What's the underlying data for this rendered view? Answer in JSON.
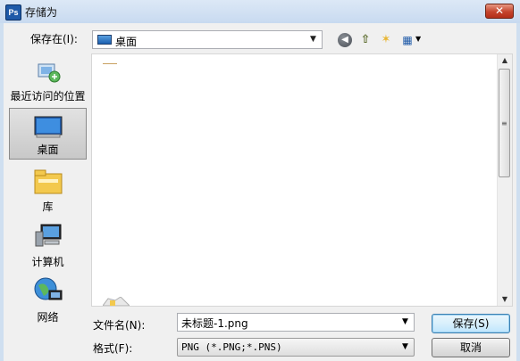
{
  "window": {
    "title": "存储为",
    "app_icon_text": "Ps",
    "close_glyph": "✕"
  },
  "location": {
    "label": "保存在(I):",
    "value": "桌面",
    "arrow": "▼"
  },
  "toolbar": {
    "back_glyph": "◀",
    "up_glyph": "⇧",
    "newfolder_glyph": "✶",
    "view_glyph": "▦",
    "view_arrow": "▼"
  },
  "places": [
    {
      "label": "最近访问的位置",
      "icon": "recent-places-icon"
    },
    {
      "label": "桌面",
      "icon": "desktop-icon",
      "selected": true
    },
    {
      "label": "库",
      "icon": "library-icon"
    },
    {
      "label": "计算机",
      "icon": "computer-icon"
    },
    {
      "label": "网络",
      "icon": "network-icon"
    }
  ],
  "scroll": {
    "up": "▲",
    "down": "▼",
    "grip": "≡"
  },
  "filename": {
    "label": "文件名(N):",
    "value": "未标题-1.png",
    "arrow": "▼"
  },
  "format": {
    "label": "格式(F):",
    "value": "PNG (*.PNG;*.PNS)",
    "arrow": "▼"
  },
  "buttons": {
    "save": "保存(S)",
    "cancel": "取消"
  },
  "colors": {
    "titlebar": "#cfdff0",
    "close": "#c5442d",
    "accent": "#3c7fb1"
  }
}
